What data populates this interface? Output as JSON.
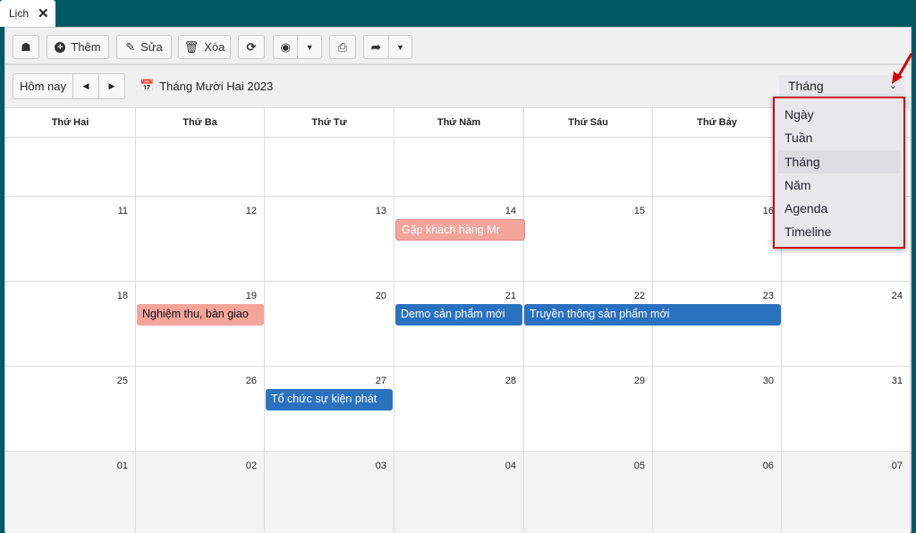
{
  "tab": {
    "label": "Lịch",
    "close": "✕"
  },
  "toolbar": {
    "add": "Thêm",
    "edit": "Sửa",
    "delete": "Xóa"
  },
  "nav": {
    "today": "Hôm nay",
    "prev": "◀",
    "next": "▶",
    "title": "Tháng Mười Hai 2023"
  },
  "view": {
    "selected": "Tháng",
    "options": [
      "Ngày",
      "Tuần",
      "Tháng",
      "Năm",
      "Agenda",
      "Timeline"
    ]
  },
  "weekdays": [
    "Thứ Hai",
    "Thứ Ba",
    "Thứ Tư",
    "Thứ Năm",
    "Thứ Sáu",
    "Thứ Bảy",
    ""
  ],
  "weeks": [
    [
      "",
      "",
      "",
      "",
      "",
      "",
      ""
    ],
    [
      "11",
      "12",
      "13",
      "14",
      "15",
      "16",
      ""
    ],
    [
      "18",
      "19",
      "20",
      "21",
      "22",
      "23",
      "24"
    ],
    [
      "25",
      "26",
      "27",
      "28",
      "29",
      "30",
      "31"
    ],
    [
      "01",
      "02",
      "03",
      "04",
      "05",
      "06",
      "07"
    ]
  ],
  "events": [
    {
      "title": "Gặp khách hàng Mr",
      "date": "14",
      "color": "#f4a49b"
    },
    {
      "title": "Nghiệm thu, bàn giao",
      "date": "19",
      "color": "#f4a49b"
    },
    {
      "title": "Demo sản phẩm mới",
      "date": "21",
      "color": "#2a72c0"
    },
    {
      "title": "Truyền thông sản phẩm mới",
      "date": "22-23",
      "color": "#2a72c0"
    },
    {
      "title": "Tổ chức sự kiện phát",
      "date": "27",
      "color": "#2a72c0"
    }
  ]
}
